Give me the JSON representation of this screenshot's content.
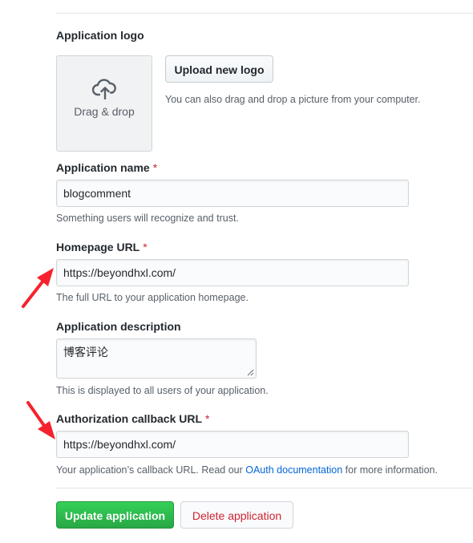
{
  "logo_section": {
    "label": "Application logo",
    "dropzone_text": "Drag & drop",
    "upload_button": "Upload new logo",
    "upload_note": "You can also drag and drop a picture from your computer."
  },
  "app_name": {
    "label": "Application name",
    "required_mark": "*",
    "value": "blogcomment",
    "note": "Something users will recognize and trust."
  },
  "homepage_url": {
    "label": "Homepage URL",
    "required_mark": "*",
    "value": "https://beyondhxl.com/",
    "note": "The full URL to your application homepage."
  },
  "description": {
    "label": "Application description",
    "value": "博客评论",
    "note": "This is displayed to all users of your application."
  },
  "callback_url": {
    "label": "Authorization callback URL",
    "required_mark": "*",
    "value": "https://beyondhxl.com/",
    "note_before": "Your application’s callback URL. Read our ",
    "note_link": "OAuth documentation",
    "note_after": " for more information."
  },
  "actions": {
    "update": "Update application",
    "delete": "Delete application"
  },
  "colors": {
    "primary": "#28a745",
    "danger": "#cb2431",
    "link": "#0366d6",
    "annotation_arrow": "#f5222d"
  },
  "icons": {
    "dropzone": "cloud-upload-icon",
    "annotation": "red-arrow-icon"
  }
}
